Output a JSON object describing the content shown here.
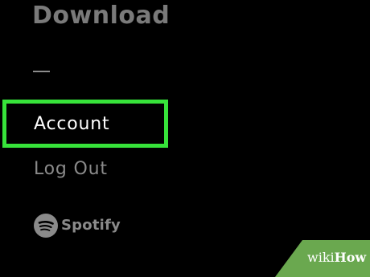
{
  "menu": {
    "download_label": "Download",
    "account_label": "Account",
    "logout_label": "Log Out"
  },
  "footer": {
    "brand_label": "Spotify"
  },
  "watermark": {
    "wiki": "wiki",
    "how": "How"
  },
  "colors": {
    "background": "#000000",
    "highlight": "#37e33a",
    "active_text": "#ffffff",
    "dim_text": "#8a8a8a",
    "watermark_bg": "#6aa84f"
  },
  "icons": [
    "spotify-logo-icon"
  ]
}
